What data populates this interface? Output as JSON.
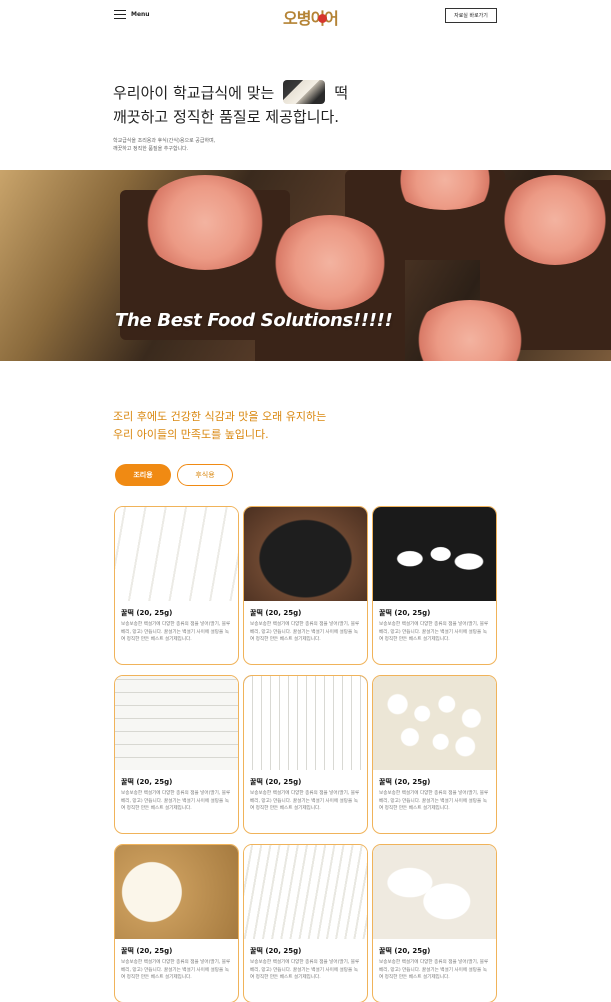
{
  "header": {
    "menu_label": "Menu",
    "logo_text": "오병이어",
    "download_label": "자료실 바로가기"
  },
  "intro": {
    "line1_a": "우리아이 학교급식에 맞는",
    "line1_b": "떡",
    "line2": "깨끗하고 정직한 품질로 제공합니다.",
    "sub1": "학교급식을 조리용과 후식(간식)용으로 공급하며,",
    "sub2": "깨끗하고 정직한 품질을 추구합니다."
  },
  "hero": {
    "title": "The Best Food Solutions!!!!!"
  },
  "section": {
    "line1": "조리 후에도 건강한 식감과 맛을 오래 유지하는",
    "line2": "우리 아이들의 만족도를 높입니다."
  },
  "tabs": [
    {
      "label": "조리용",
      "active": true
    },
    {
      "label": "후식용",
      "active": false
    }
  ],
  "products": [
    {
      "name": "꿀떡 (20, 25g)",
      "desc": "보송보송한 백설기에 다양한 종류의 잼을 넣어(딸기, 블루베리, 망고) 만듭니다. 꿀설기는 백설기 사이에 설탕을 녹여 정직한 만든 베스트 설기제입니다.",
      "image": "cylinder-rice-cakes"
    },
    {
      "name": "꿀떡 (20, 25g)",
      "desc": "보송보송한 백설기에 다양한 종류의 잼을 넣어(딸기, 블루베리, 망고) 만듭니다. 꿀설기는 백설기 사이에 설탕을 녹여 정직한 만든 베스트 설기제입니다.",
      "image": "rice-cakes-on-dark-plate"
    },
    {
      "name": "꿀떡 (20, 25g)",
      "desc": "보송보송한 백설기에 다양한 종류의 잼을 넣어(딸기, 블루베리, 망고) 만듭니다. 꿀설기는 백설기 사이에 설탕을 녹여 정직한 만든 베스트 설기제입니다.",
      "image": "oval-rice-cakes"
    },
    {
      "name": "꿀떡 (20, 25g)",
      "desc": "보송보송한 백설기에 다양한 종류의 잼을 넣어(딸기, 블루베리, 망고) 만듭니다. 꿀설기는 백설기 사이에 설탕을 녹여 정직한 만든 베스트 설기제입니다.",
      "image": "sliced-rice-cakes"
    },
    {
      "name": "꿀떡 (20, 25g)",
      "desc": "보송보송한 백설기에 다양한 종류의 잼을 넣어(딸기, 블루베리, 망고) 만듭니다. 꿀설기는 백설기 사이에 설탕을 녹여 정직한 만든 베스트 설기제입니다.",
      "image": "long-rice-sticks"
    },
    {
      "name": "꿀떡 (20, 25g)",
      "desc": "보송보송한 백설기에 다양한 종류의 잼을 넣어(딸기, 블루베리, 망고) 만듭니다. 꿀설기는 백설기 사이에 설탕을 녹여 정직한 만든 베스트 설기제입니다.",
      "image": "rice-balls"
    },
    {
      "name": "꿀떡 (20, 25g)",
      "desc": "보송보송한 백설기에 다양한 종류의 잼을 넣어(딸기, 블루베리, 망고) 만듭니다. 꿀설기는 백설기 사이에 설탕을 녹여 정직한 만든 베스트 설기제입니다.",
      "image": "heart-rice-cakes"
    },
    {
      "name": "꿀떡 (20, 25g)",
      "desc": "보송보송한 백설기에 다양한 종류의 잼을 넣어(딸기, 블루베리, 망고) 만듭니다. 꿀설기는 백설기 사이에 설탕을 녹여 정직한 만든 베스트 설기제입니다.",
      "image": "rice-cakes-with-leaves"
    },
    {
      "name": "꿀떡 (20, 25g)",
      "desc": "보송보송한 백설기에 다양한 종류의 잼을 넣어(딸기, 블루베리, 망고) 만듭니다. 꿀설기는 백설기 사이에 설탕을 녹여 정직한 만든 베스트 설기제입니다.",
      "image": "piled-rice-cakes"
    }
  ],
  "colors": {
    "accent": "#f08a13",
    "accent_text": "#d9870f",
    "card_border": "#f0b35a"
  }
}
